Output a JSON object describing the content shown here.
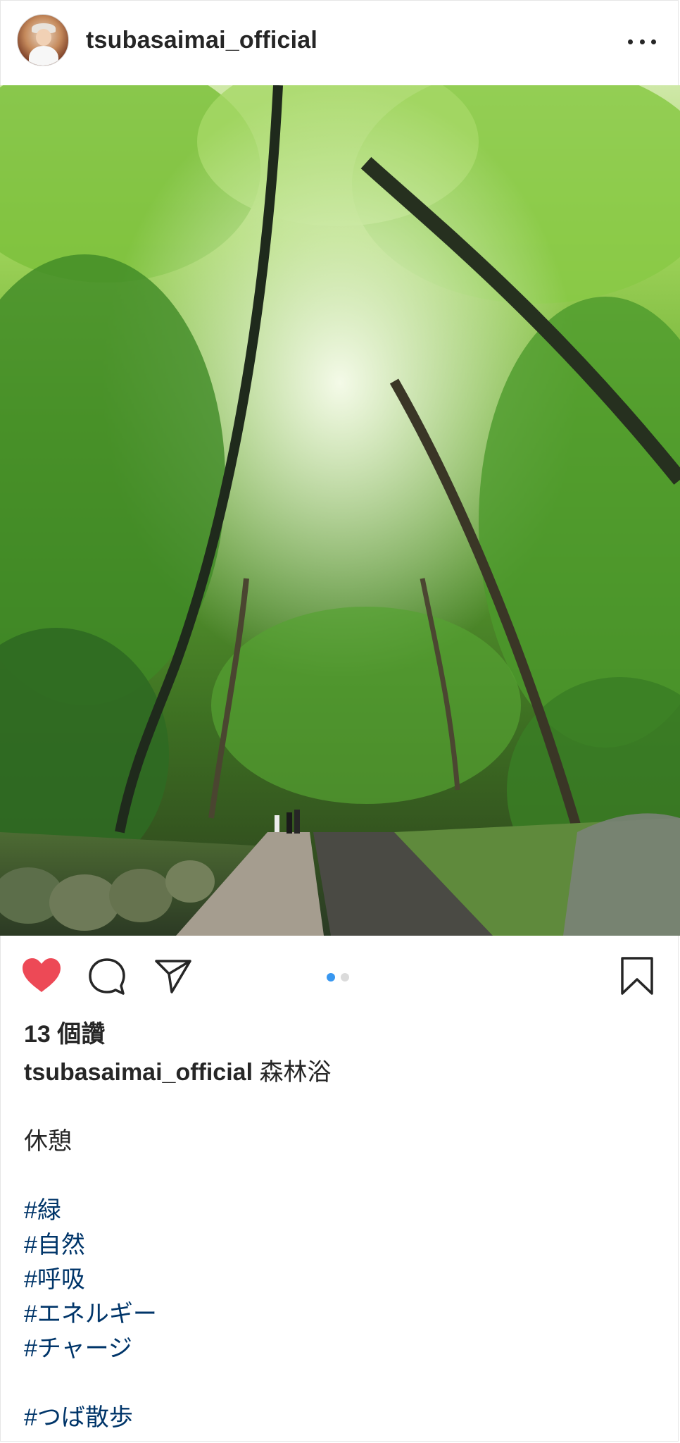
{
  "header": {
    "username": "tsubasaimai_official",
    "avatar_icon": "avatar",
    "more_icon": "more-options-icon"
  },
  "post": {
    "image_description_icon": "forest-path-photo",
    "carousel": {
      "count": 2,
      "active_index": 0,
      "active_color": "#3897f0",
      "inactive_color": "#dbdbdb"
    },
    "liked": true,
    "like_color": "#ed4956"
  },
  "actions": {
    "like_icon": "heart-icon",
    "comment_icon": "comment-icon",
    "share_icon": "share-icon",
    "save_icon": "bookmark-icon"
  },
  "likes_text": "13 個讚",
  "caption": {
    "username": "tsubasaimai_official",
    "first_line": "森林浴",
    "lines": [
      "",
      "休憩",
      "",
      "#緑",
      "#自然",
      "#呼吸",
      "#エネルギー",
      "#チャージ",
      "",
      "#つば散歩"
    ]
  }
}
